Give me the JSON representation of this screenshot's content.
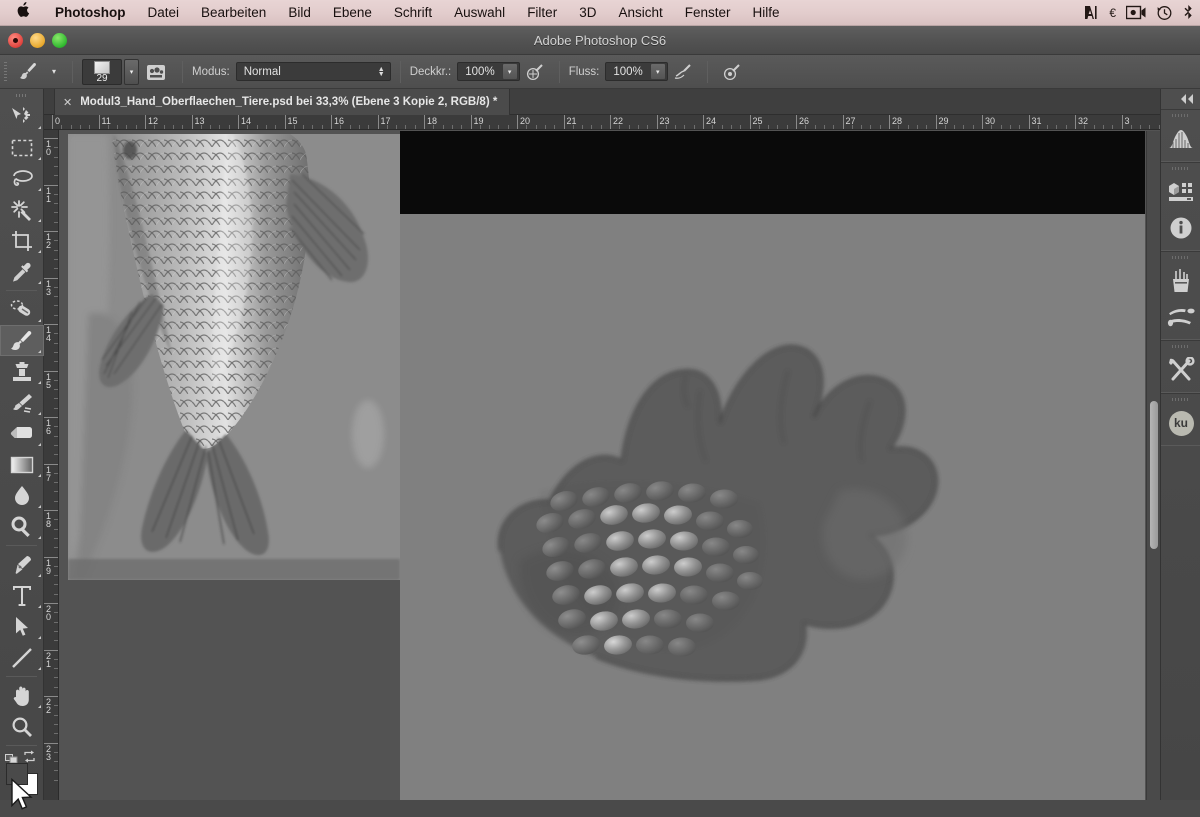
{
  "menubar": {
    "apple_icon": "apple-logo-icon",
    "items": [
      {
        "label": "Photoshop",
        "bold": true
      },
      {
        "label": "Datei",
        "bold": false
      },
      {
        "label": "Bearbeiten",
        "bold": false
      },
      {
        "label": "Bild",
        "bold": false
      },
      {
        "label": "Ebene",
        "bold": false
      },
      {
        "label": "Schrift",
        "bold": false
      },
      {
        "label": "Auswahl",
        "bold": false
      },
      {
        "label": "Filter",
        "bold": false
      },
      {
        "label": "3D",
        "bold": false
      },
      {
        "label": "Ansicht",
        "bold": false
      },
      {
        "label": "Fenster",
        "bold": false
      },
      {
        "label": "Hilfe",
        "bold": false
      }
    ],
    "status_icons": [
      "adobe-a-logo-icon",
      "euro-symbol-icon",
      "screen-recording-camera-icon",
      "time-machine-clock-icon",
      "bluetooth-icon"
    ],
    "background_color": "#e2cccc"
  },
  "window": {
    "title": "Adobe Photoshop CS6",
    "traffic_lights": [
      {
        "name": "close-button",
        "color": "#e0443e"
      },
      {
        "name": "minimize-button",
        "color": "#e8a82c"
      },
      {
        "name": "zoom-button",
        "color": "#2fb82f"
      }
    ]
  },
  "options_bar": {
    "tool_icon": "brush-tool-icon",
    "tool_preset_caret": "▾",
    "brush_size": "29",
    "brush_panel_icon": "brush-panel-toggle-icon",
    "mode_label": "Modus:",
    "mode_value": "Normal",
    "opacity_label": "Deckkr.:",
    "opacity_value": "100%",
    "opacity_pressure_icon": "opacity-pressure-icon",
    "flow_label": "Fluss:",
    "flow_value": "100%",
    "flow_pressure_icon": "flow-pressure-icon",
    "airbrush_icon": "airbrush-icon"
  },
  "document_tab": {
    "close_glyph": "✕",
    "title": "Modul3_Hand_Oberflaechen_Tiere.psd bei 33,3% (Ebene 3 Kopie 2, RGB/8) *"
  },
  "rulers": {
    "unit": "cm",
    "horizontal_labels": [
      "0",
      "11",
      "12",
      "13",
      "14",
      "15",
      "16",
      "17",
      "18",
      "19",
      "20",
      "21",
      "22",
      "23",
      "24",
      "25",
      "26",
      "27",
      "28",
      "29",
      "30",
      "31",
      "32",
      "3"
    ],
    "vertical_labels": [
      "10",
      "11",
      "12",
      "13",
      "14",
      "15",
      "16",
      "17",
      "18",
      "19",
      "20",
      "21",
      "22",
      "23"
    ]
  },
  "toolbar": {
    "items": [
      {
        "name": "move-tool",
        "icon": "move-tool-icon",
        "active": false,
        "hasCorner": true
      },
      {
        "name": "rectangular-marquee-tool",
        "icon": "marquee-tool-icon",
        "active": false,
        "hasCorner": true
      },
      {
        "name": "lasso-tool",
        "icon": "lasso-tool-icon",
        "active": false,
        "hasCorner": true
      },
      {
        "name": "magic-wand-tool",
        "icon": "magic-wand-tool-icon",
        "active": false,
        "hasCorner": true
      },
      {
        "name": "crop-tool",
        "icon": "crop-tool-icon",
        "active": false,
        "hasCorner": true
      },
      {
        "name": "eyedropper-tool",
        "icon": "eyedropper-tool-icon",
        "active": false,
        "hasCorner": true
      },
      {
        "name": "separator",
        "icon": "separator",
        "active": false,
        "hasCorner": false
      },
      {
        "name": "spot-healing-brush-tool",
        "icon": "healing-brush-tool-icon",
        "active": false,
        "hasCorner": true
      },
      {
        "name": "brush-tool",
        "icon": "brush-tool-icon",
        "active": true,
        "hasCorner": true
      },
      {
        "name": "clone-stamp-tool",
        "icon": "clone-stamp-tool-icon",
        "active": false,
        "hasCorner": true
      },
      {
        "name": "history-brush-tool",
        "icon": "history-brush-tool-icon",
        "active": false,
        "hasCorner": true
      },
      {
        "name": "eraser-tool",
        "icon": "eraser-tool-icon",
        "active": false,
        "hasCorner": true
      },
      {
        "name": "gradient-tool",
        "icon": "gradient-tool-icon",
        "active": false,
        "hasCorner": true
      },
      {
        "name": "blur-tool",
        "icon": "blur-droplet-tool-icon",
        "active": false,
        "hasCorner": true
      },
      {
        "name": "dodge-tool",
        "icon": "dodge-tool-icon",
        "active": false,
        "hasCorner": true
      },
      {
        "name": "separator",
        "icon": "separator",
        "active": false,
        "hasCorner": false
      },
      {
        "name": "pen-tool",
        "icon": "pen-tool-icon",
        "active": false,
        "hasCorner": true
      },
      {
        "name": "type-tool",
        "icon": "type-tool-icon",
        "active": false,
        "hasCorner": true
      },
      {
        "name": "path-selection-tool",
        "icon": "path-selection-tool-icon",
        "active": false,
        "hasCorner": true
      },
      {
        "name": "line-tool",
        "icon": "line-shape-tool-icon",
        "active": false,
        "hasCorner": true
      },
      {
        "name": "separator",
        "icon": "separator",
        "active": false,
        "hasCorner": false
      },
      {
        "name": "hand-tool",
        "icon": "hand-tool-icon",
        "active": false,
        "hasCorner": true
      },
      {
        "name": "zoom-tool",
        "icon": "zoom-magnifier-tool-icon",
        "active": false,
        "hasCorner": false
      }
    ],
    "foreground_color": "#4a4a4a",
    "background_color": "#ffffff",
    "swap_icon": "swap-colors-icon",
    "default_colors_icon": "default-colors-icon"
  },
  "dock": {
    "collapse_icon": "collapse-panels-icon",
    "groups": [
      {
        "buttons": [
          {
            "name": "histogram-panel-button",
            "icon": "histogram-icon"
          }
        ]
      },
      {
        "buttons": [
          {
            "name": "properties-panel-button",
            "icon": "properties-3d-icon"
          },
          {
            "name": "info-panel-button",
            "icon": "info-circle-icon"
          }
        ]
      },
      {
        "buttons": [
          {
            "name": "brush-presets-panel-button",
            "icon": "brush-presets-icon"
          },
          {
            "name": "brush-panel-button",
            "icon": "brush-icon"
          }
        ]
      },
      {
        "buttons": [
          {
            "name": "tool-presets-panel-button",
            "icon": "wrench-screwdriver-icon"
          }
        ]
      },
      {
        "buttons": [
          {
            "name": "kuler-panel-button",
            "icon": "kuler-badge-icon",
            "label": "ku"
          }
        ]
      }
    ]
  },
  "canvas": {
    "artwork_name": "hand-with-fish-scales-painting",
    "reference_image_name": "carp-tail-reference-photo",
    "zoom_level": "33,3%",
    "background_color": "#808080",
    "top_band_color": "#0a0a0a"
  },
  "scrollbar": {
    "name": "canvas-vertical-scrollbar",
    "thumb_position_percent": 40
  },
  "cursor": {
    "name": "mouse-pointer-cursor"
  }
}
